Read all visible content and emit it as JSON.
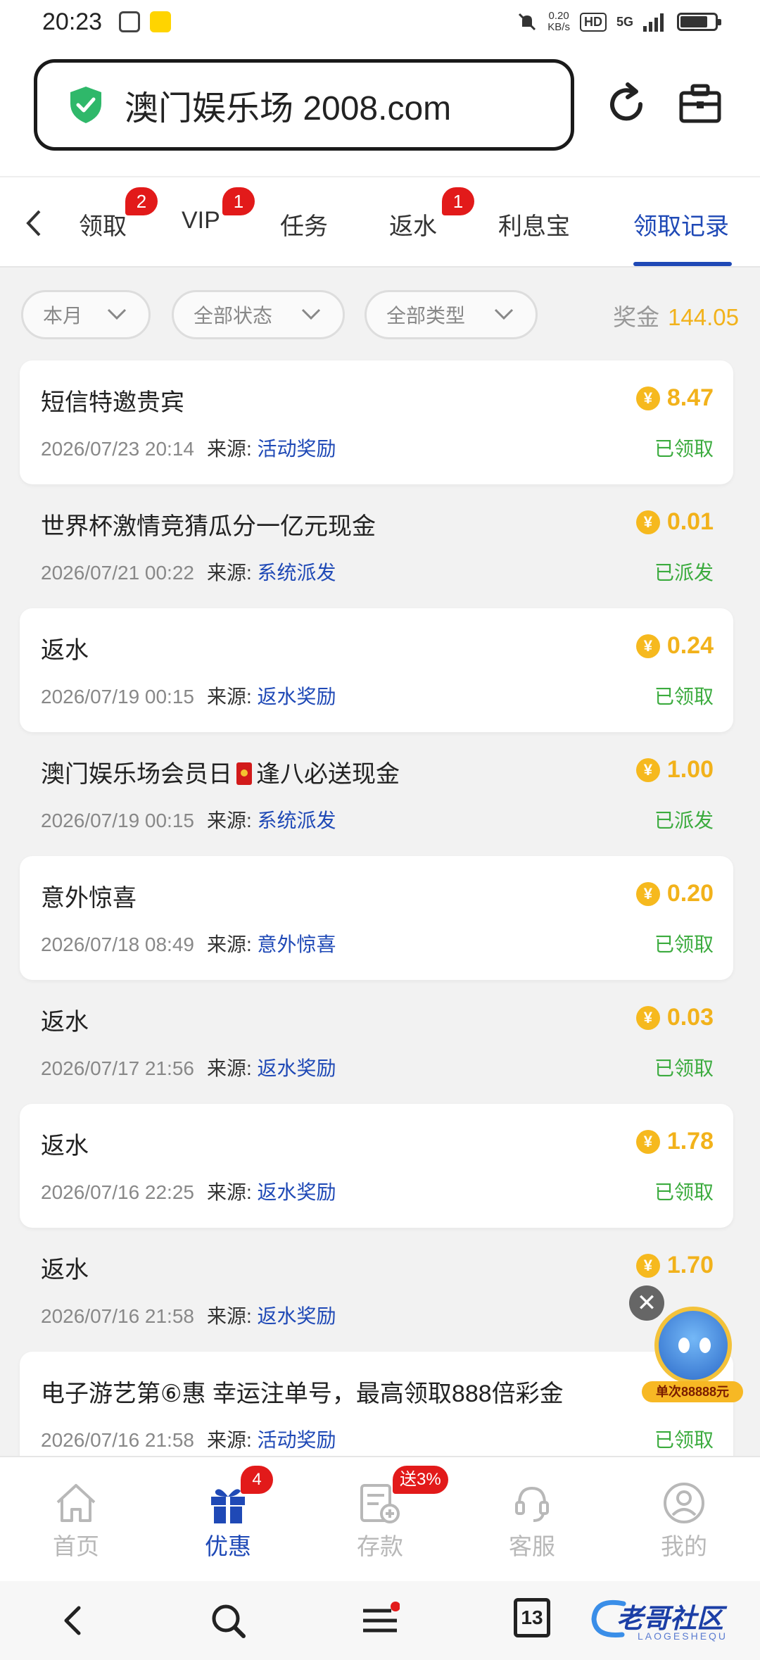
{
  "status_bar": {
    "time": "20:23",
    "speed": "0.20",
    "speed_unit": "KB/s",
    "hd": "HD",
    "network": "5G",
    "battery_level": 0.8
  },
  "browser": {
    "url": "澳门娱乐场 2008.com"
  },
  "tabs": [
    {
      "label": "领取",
      "badge": "2"
    },
    {
      "label": "VIP",
      "badge": "1"
    },
    {
      "label": "任务",
      "badge": ""
    },
    {
      "label": "返水",
      "badge": "1"
    },
    {
      "label": "利息宝",
      "badge": ""
    },
    {
      "label": "领取记录",
      "badge": ""
    }
  ],
  "filters": {
    "month": "本月",
    "status": "全部状态",
    "type": "全部类型",
    "bonus_label": "奖金",
    "bonus_amount": "144.05"
  },
  "records": [
    {
      "title": "短信特邀贵宾",
      "date": "2026/07/23 20:14",
      "source_label": "来源:",
      "source": "活动奖励",
      "amount": "8.47",
      "status": "已领取"
    },
    {
      "title": "世界杯激情竞猜瓜分一亿元现金",
      "date": "2026/07/21 00:22",
      "source_label": "来源:",
      "source": "系统派发",
      "amount": "0.01",
      "status": "已派发"
    },
    {
      "title": "返水",
      "date": "2026/07/19 00:15",
      "source_label": "来源:",
      "source": "返水奖励",
      "amount": "0.24",
      "status": "已领取"
    },
    {
      "title_part1": "澳门娱乐场会员日",
      "title_part2": "逢八必送现金",
      "date": "2026/07/19 00:15",
      "source_label": "来源:",
      "source": "系统派发",
      "amount": "1.00",
      "status": "已派发"
    },
    {
      "title": "意外惊喜",
      "date": "2026/07/18 08:49",
      "source_label": "来源:",
      "source": "意外惊喜",
      "amount": "0.20",
      "status": "已领取"
    },
    {
      "title": "返水",
      "date": "2026/07/17 21:56",
      "source_label": "来源:",
      "source": "返水奖励",
      "amount": "0.03",
      "status": "已领取"
    },
    {
      "title": "返水",
      "date": "2026/07/16 22:25",
      "source_label": "来源:",
      "source": "返水奖励",
      "amount": "1.78",
      "status": "已领取"
    },
    {
      "title": "返水",
      "date": "2026/07/16 21:58",
      "source_label": "来源:",
      "source": "返水奖励",
      "amount": "1.70",
      "status": ""
    },
    {
      "title": "电子游艺第⑥惠 幸运注单号，最高领取888倍彩金",
      "date": "2026/07/16 21:58",
      "source_label": "来源:",
      "source": "活动奖励",
      "amount": "",
      "status": "已领取"
    }
  ],
  "coin_symbol": "¥",
  "promo": {
    "close": "✕",
    "label": "单次88888元"
  },
  "bottom_nav": [
    {
      "label": "首页",
      "icon": "home-icon",
      "badge": ""
    },
    {
      "label": "优惠",
      "icon": "gift-icon",
      "badge": "4"
    },
    {
      "label": "存款",
      "icon": "deposit-icon",
      "badge": "送3%"
    },
    {
      "label": "客服",
      "icon": "support-icon",
      "badge": ""
    },
    {
      "label": "我的",
      "icon": "profile-icon",
      "badge": ""
    }
  ],
  "system_nav": {
    "tab_count": "13",
    "watermark": "老哥社区",
    "watermark_sub": "LAOGESHEQU"
  },
  "colors": {
    "accent": "#1f49b6",
    "gold": "#f2b21b",
    "success": "#3bab3e",
    "badge": "#e21a1a"
  }
}
